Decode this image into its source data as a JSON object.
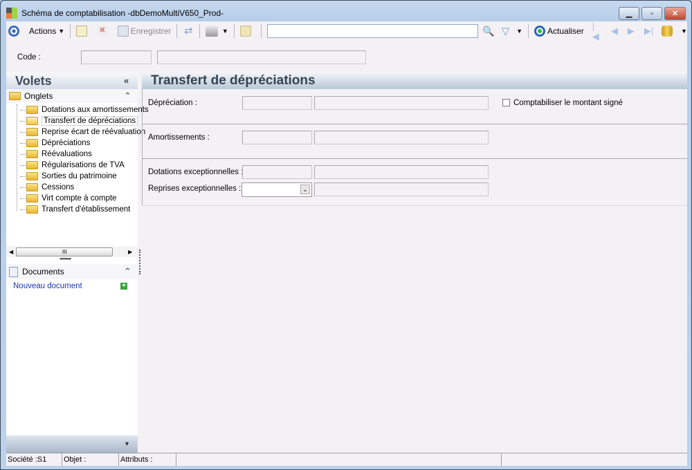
{
  "window": {
    "title": "Schéma de comptabilisation -dbDemoMultiV650_Prod-"
  },
  "toolbar": {
    "actions": "Actions",
    "save": "Enregistrer",
    "search_value": "",
    "refresh": "Actualiser"
  },
  "code": {
    "label": "Code :",
    "value": "",
    "description": ""
  },
  "sidebar": {
    "title": "Volets",
    "onglets": {
      "title": "Onglets",
      "items": [
        {
          "label": "Dotations aux amortissements"
        },
        {
          "label": "Transfert de dépréciations",
          "selected": true
        },
        {
          "label": "Reprise écart de réévaluation"
        },
        {
          "label": "Dépréciations"
        },
        {
          "label": "Réévaluations"
        },
        {
          "label": "Régularisations de TVA"
        },
        {
          "label": "Sorties du patrimoine"
        },
        {
          "label": "Cessions"
        },
        {
          "label": "Virt compte à compte"
        },
        {
          "label": "Transfert d'établissement"
        }
      ]
    },
    "documents": {
      "title": "Documents",
      "new_doc": "Nouveau document"
    }
  },
  "main": {
    "title": "Transfert de dépréciations",
    "depreciation_label": "Dépréciation :",
    "signed_checkbox": "Comptabiliser le montant signé",
    "signed_checked": false,
    "amortissements_label": "Amortissements :",
    "dotations_label": "Dotations exceptionnelles :",
    "reprises_label": "Reprises exceptionnelles :"
  },
  "status": {
    "societe": "Société :S1",
    "objet": "Objet :",
    "attributs": "Attributs :"
  }
}
